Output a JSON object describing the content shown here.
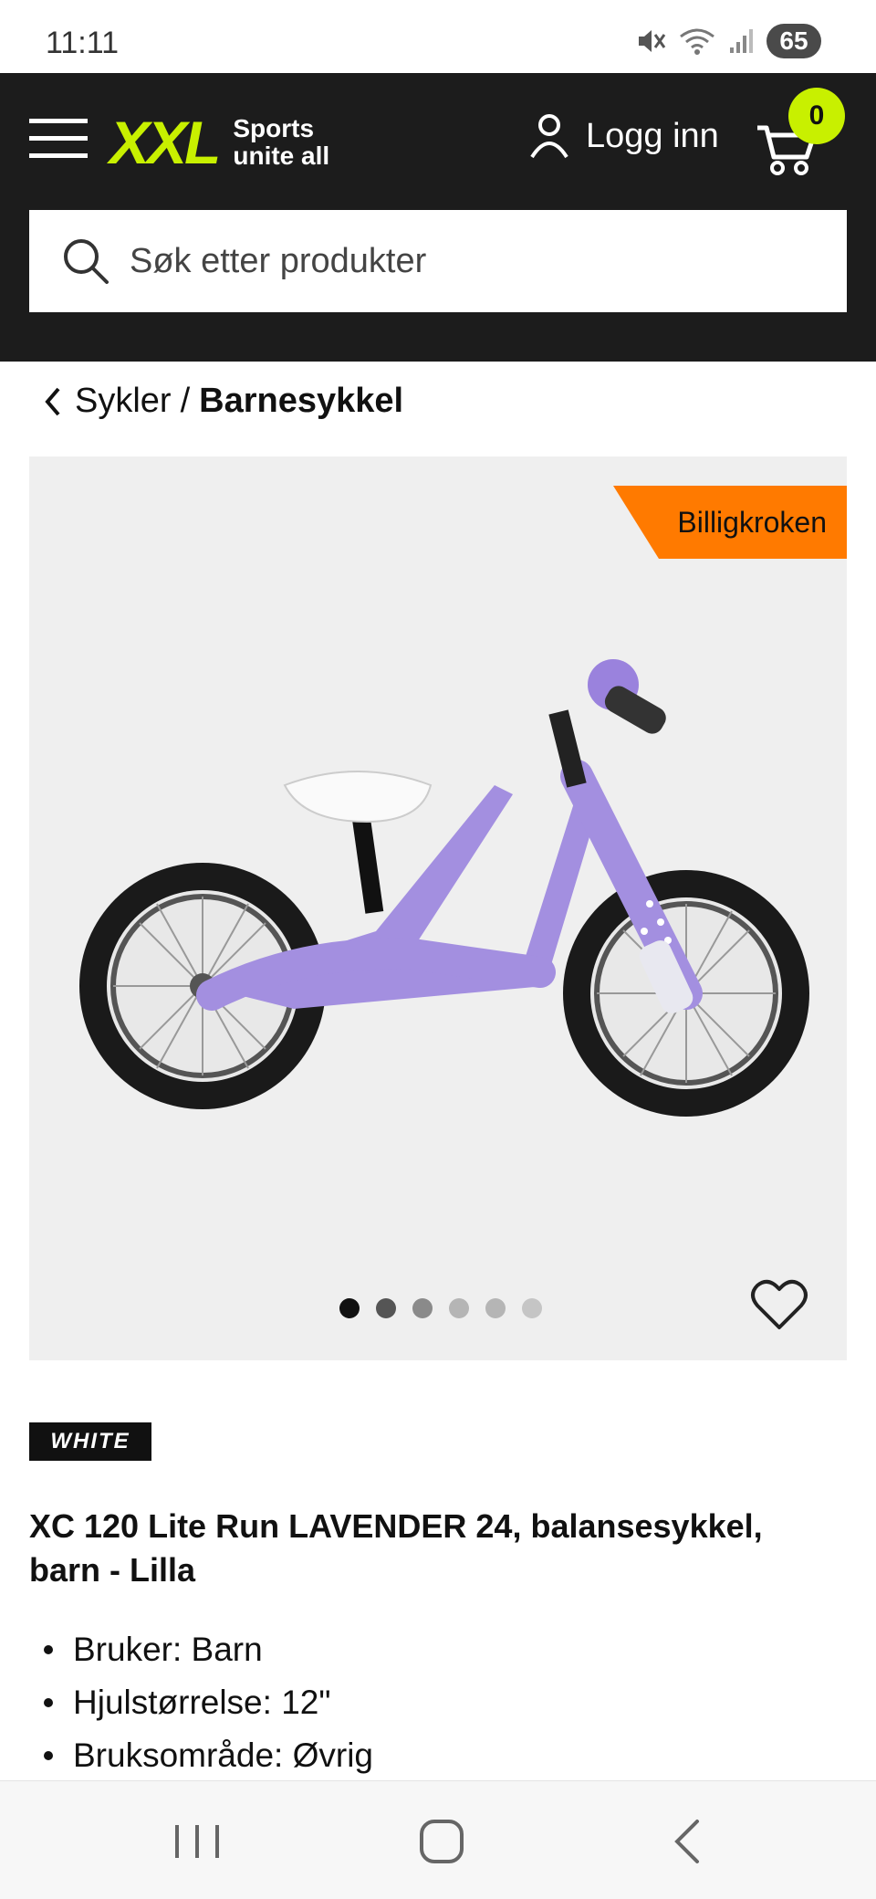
{
  "status_bar": {
    "time": "11:11",
    "battery": "65"
  },
  "header": {
    "logo_mark": "XXL",
    "logo_tagline_1": "Sports",
    "logo_tagline_2": "unite all",
    "login_label": "Logg inn",
    "cart_count": "0",
    "accent_color": "#c8f000"
  },
  "search": {
    "placeholder": "Søk etter produkter"
  },
  "breadcrumb": {
    "parent": "Sykler",
    "separator": "/",
    "current": "Barnesykkel"
  },
  "product": {
    "badge": "Billigkroken",
    "badge_color": "#ff7a00",
    "bike_color": "#a38fe0",
    "image_count": 6,
    "active_image": 1,
    "brand": "WHITE",
    "title": "XC 120 Lite Run LAVENDER 24, balansesykkel, barn - Lilla",
    "specs": [
      "Bruker: Barn",
      "Hjulstørrelse: 12\"",
      "Bruksområde: Øvrig"
    ]
  }
}
